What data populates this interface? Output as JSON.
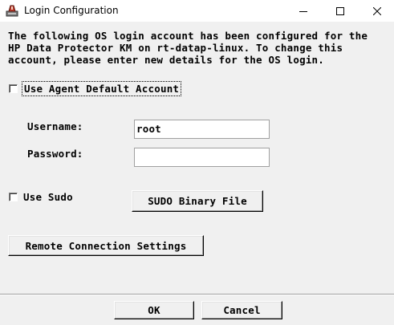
{
  "window": {
    "title": "Login Configuration",
    "icons": {
      "app": "hp-data-protector-app-icon",
      "minimize": "minimize-icon",
      "maximize": "maximize-icon",
      "close": "close-icon"
    }
  },
  "description": "The following OS login account has been configured for the\nHP Data Protector KM on rt-datap-linux. To change this\naccount, please enter new details for the OS login.",
  "agent_default": {
    "label": "Use Agent Default Account",
    "checked": false
  },
  "username": {
    "label": "Username:",
    "value": "root"
  },
  "password": {
    "label": "Password:",
    "value": ""
  },
  "sudo": {
    "label": "Use Sudo",
    "checked": false,
    "binary_button": "SUDO Binary File"
  },
  "remote_button": "Remote Connection Settings",
  "footer": {
    "ok": "OK",
    "cancel": "Cancel"
  }
}
